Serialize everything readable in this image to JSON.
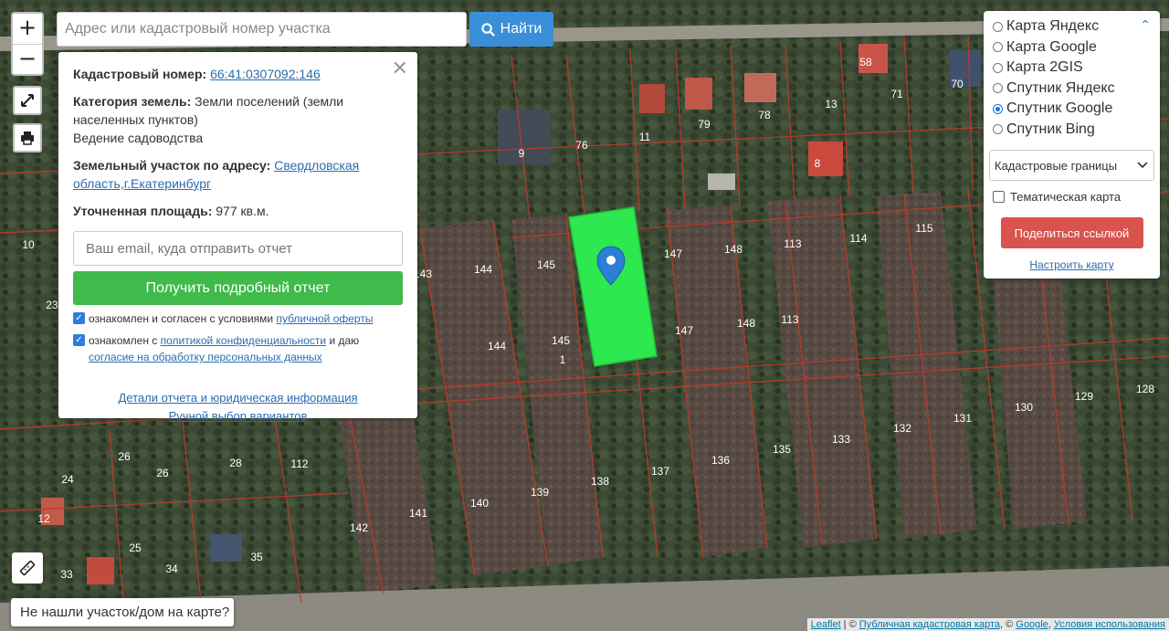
{
  "search": {
    "placeholder": "Адрес или кадастровый номер участка",
    "button": "Найти"
  },
  "zoom": {
    "in": "+",
    "out": "−"
  },
  "info": {
    "cad_label": "Кадастровый номер:",
    "cad_value": "66:41:0307092:146",
    "category_label": "Категория земель:",
    "category_value": "Земли поселений (земли населенных пунктов)",
    "use_value": "Ведение садоводства",
    "address_label": "Земельный участок по адресу:",
    "address_value": "Свердловская область,г.Екатеринбург",
    "area_label": "Уточненная площадь:",
    "area_value": "977 кв.м.",
    "email_placeholder": "Ваш email, куда отправить отчет",
    "report_button": "Получить подробный отчет",
    "consent1_text": "ознакомлен и согласен с условиями",
    "consent1_link": "публичной оферты",
    "consent2_text_a": "ознакомлен с",
    "consent2_link_a": "политикой конфиденциальности",
    "consent2_text_b": "и даю",
    "consent2_link_b": "согласие на обработку персональных данных",
    "details_link": "Детали отчета и юридическая информация",
    "manual_link": "Ручной выбор вариантов"
  },
  "layers": {
    "options": [
      "Карта Яндекс",
      "Карта Google",
      "Карта 2GIS",
      "Спутник Яндекс",
      "Спутник Google",
      "Спутник Bing"
    ],
    "selected_index": 4,
    "overlay_select": "Кадастровые границы",
    "thematic": "Тематическая карта",
    "share": "Поделиться ссылкой",
    "configure": "Настроить карту"
  },
  "not_found": "Не нашли участок/дом на карте?",
  "attribution": {
    "leaflet": "Leaflet",
    "sep": " | © ",
    "pkk": "Публичная кадастровая карта",
    "google": "Google",
    "terms": "Условия использования"
  },
  "parcel_labels": [
    "9",
    "76",
    "11",
    "79",
    "78",
    "13",
    "58",
    "71",
    "70",
    "8",
    "145",
    "144",
    "147",
    "148",
    "113",
    "114",
    "115",
    "143",
    "144",
    "145",
    "147",
    "148",
    "113",
    "1",
    "10",
    "23",
    "132",
    "131",
    "130",
    "129",
    "128",
    "133",
    "135",
    "136",
    "137",
    "138",
    "139",
    "140",
    "141",
    "142",
    "26",
    "26",
    "28",
    "24",
    "112",
    "34",
    "33",
    "35",
    "25",
    "12"
  ],
  "colors": {
    "selected_parcel": "#2ee84f",
    "boundary": "#c0392b",
    "marker": "#2b7fd4"
  }
}
